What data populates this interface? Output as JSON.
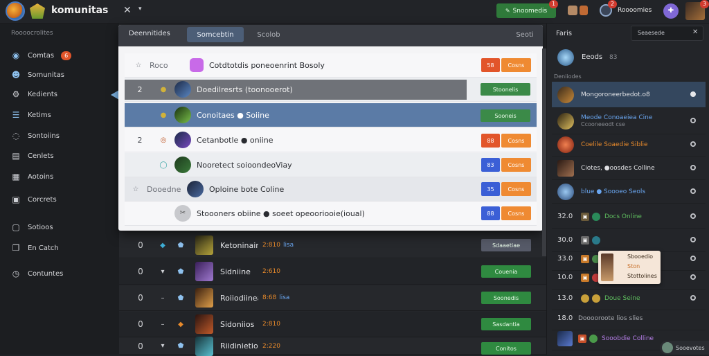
{
  "topbar": {
    "app_name": "komunitas",
    "close_icon": "close-icon",
    "dropdown_icon": "chevron-down-icon",
    "green_button_label": "Snoomedis",
    "green_button_badge": "1",
    "user_name": "Roooomies",
    "user_badge": "2",
    "avatar_badge": "3"
  },
  "sidebar": {
    "heading": "Roooocrolites",
    "items": [
      {
        "label": "Comtas",
        "icon": "globe-icon",
        "badge": "6"
      },
      {
        "label": "Somunitas",
        "icon": "users-icon"
      },
      {
        "label": "Kedients",
        "icon": "gear-icon"
      },
      {
        "label": "Ketims",
        "icon": "list-icon"
      },
      {
        "label": "Sontoiins",
        "icon": "chat-icon"
      },
      {
        "label": "Cenlets",
        "icon": "document-icon"
      },
      {
        "label": "Aotoins",
        "icon": "grid-icon"
      },
      {
        "label": "Corcrets",
        "icon": "inbox-icon"
      },
      {
        "label": "Sotioos",
        "icon": "page-icon"
      },
      {
        "label": "En Catch",
        "icon": "copy-icon"
      },
      {
        "label": "Contuntes",
        "icon": "clock-icon"
      }
    ]
  },
  "main": {
    "tabs": [
      {
        "label": "Deennitides"
      },
      {
        "label": "Somcebtin"
      },
      {
        "label": "Scolob"
      },
      {
        "label": "Seoti"
      }
    ],
    "rows": [
      {
        "num": "0",
        "name": "Ketoninainng",
        "stat": "2:810",
        "stat2": "lisa",
        "btn": "Sdaaetiae",
        "btn_color": "#565a68"
      },
      {
        "num": "0",
        "name": "Sidniine",
        "stat": "2:610",
        "stat2": "",
        "btn": "Couenia",
        "btn_color": "#2f8a40"
      },
      {
        "num": "0",
        "name": "Roiiodiinear",
        "stat": "8:68",
        "stat2": "lisa",
        "btn": "Soonedis",
        "btn_color": "#2f8a40"
      },
      {
        "num": "0",
        "name": "Sidoniios",
        "stat": "2:810",
        "stat2": "",
        "btn": "Sasdantia",
        "btn_color": "#2f8a40"
      },
      {
        "num": "0",
        "name": "Riidinietio",
        "stat": "2:220",
        "stat2": "",
        "btn": "Conitos",
        "btn_color": "#2f8a40"
      }
    ]
  },
  "modal": {
    "header": {
      "title": "Deennitides",
      "tab_active": "Somcebtin",
      "tab_plain": "Scolob",
      "right": "Seoti"
    },
    "rows": [
      {
        "num": "",
        "label": "Roco",
        "text": "Cotdtotdis poneoenrint Bosoly",
        "tag1": "58",
        "tag1_color": "#e2552a",
        "tag2": "Cosns"
      },
      {
        "num": "2",
        "label": "",
        "text": "Doedilresrts (toonooerot)",
        "btn": "Stoonelis",
        "highlight": "grey"
      },
      {
        "num": "",
        "label": "",
        "text": "Conoitaes ● Soiine",
        "btn": "Sooneis",
        "highlight": "blue"
      },
      {
        "num": "2",
        "label": "",
        "text": "Cetanbotle ● oniine",
        "tag1": "88",
        "tag1_color": "#e2552a",
        "tag2": "Cosns"
      },
      {
        "num": "",
        "label": "",
        "text": "Nooretect  soioondeoViay",
        "tag1": "83",
        "tag1_color": "#3b5fd6",
        "tag2": "Cosns"
      },
      {
        "num": "",
        "label": "Dooedne",
        "text": "Oploine bote Coline",
        "tag1": "35",
        "tag1_color": "#3b5fd6",
        "tag2": "Cosns"
      },
      {
        "num": "",
        "label": "",
        "text": "Stoooners obiine ● soeet opeooriooie(ioual)",
        "tag1": "88",
        "tag1_color": "#3b5fd6",
        "tag2": "Cosns"
      }
    ]
  },
  "right": {
    "header": "Faris",
    "search_label": "Seaesede",
    "top_user": "Eeods",
    "top_user_count": "83",
    "section": "Deniiodes",
    "rows": [
      {
        "text": "Mongoroneerbedot.o8",
        "color": "#e4e5e8",
        "selected": true
      },
      {
        "text": "Meode Conoaeiea Cine",
        "color": "#6aa6f0",
        "sub": "Ccooneeodt cse"
      },
      {
        "text": "Coelile Soaedie Siblie",
        "color": "#e88a2b"
      },
      {
        "text": "Ciotes, ●oosdes Colline",
        "color": "#e4e5e8"
      },
      {
        "text": "blue ● Soooeo Seols",
        "color": "#6aa6f0"
      }
    ],
    "num_rows": [
      {
        "num": "32.0",
        "text": "Docs Online",
        "color": "#5fbf5f"
      },
      {
        "num": "30.0",
        "text": "",
        "color": "#e4e5e8"
      },
      {
        "num": "33.0",
        "text": "",
        "color": "#e4e5e8"
      },
      {
        "num": "10.0",
        "text": "",
        "color": "#e4e5e8"
      },
      {
        "num": "13.0",
        "text": "Doue Seine",
        "color": "#5fbf5f"
      },
      {
        "num": "18.0",
        "text": "Dooooroote lios slies",
        "color": "#a9acb2"
      },
      {
        "num": "",
        "text": "Sooobdie Colline",
        "color": "#b57ee8"
      }
    ],
    "tooltip": {
      "line1": "Sbooedio",
      "line2": "Ston",
      "line3": "Stottolines"
    },
    "footer_label": "Sooevotes"
  }
}
